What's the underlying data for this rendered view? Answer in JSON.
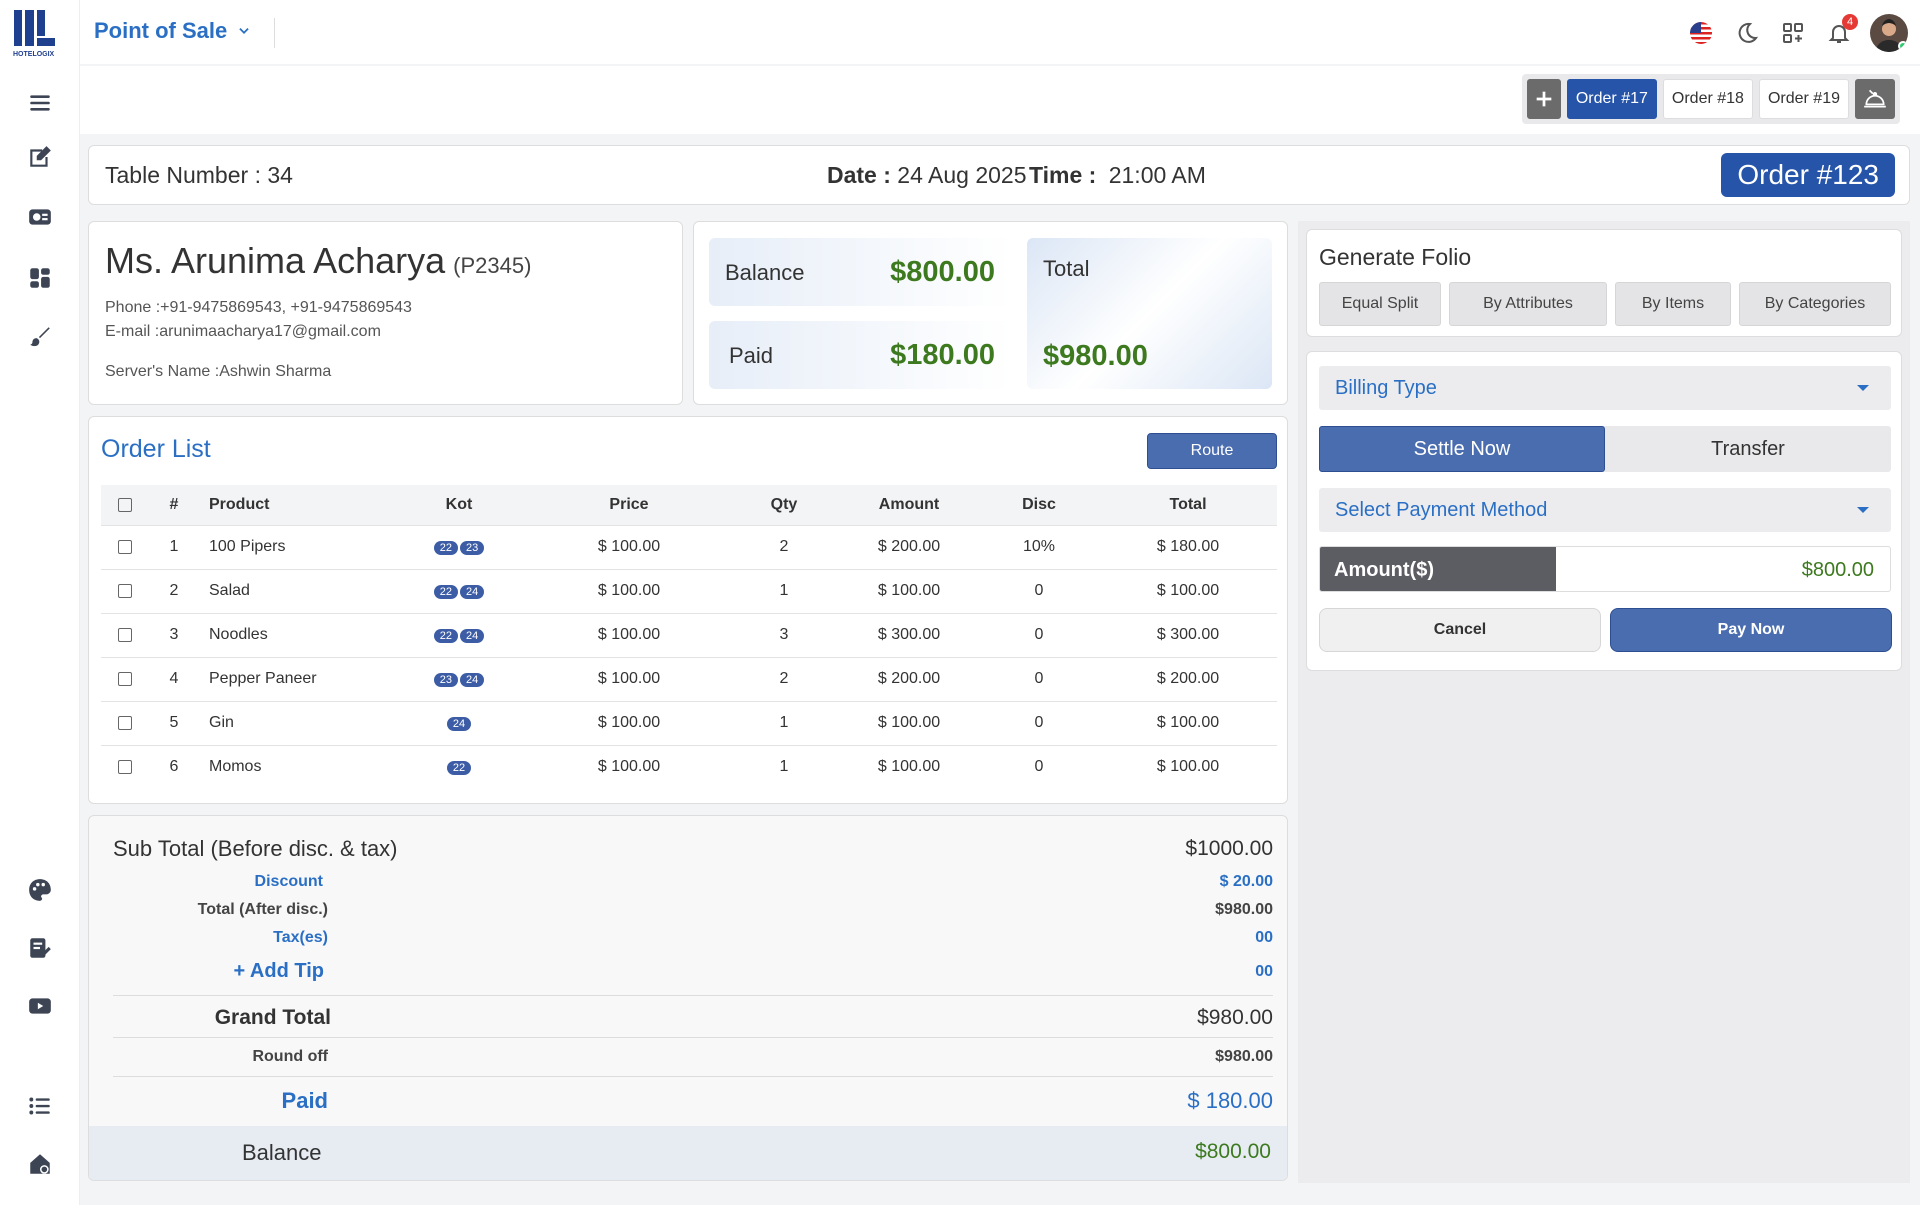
{
  "app": {
    "title": "Point of Sale",
    "logo_text": "HOTELOGIX"
  },
  "notifications": {
    "count": "4"
  },
  "order_tabs": [
    "Order #17",
    "Order #18",
    "Order #19"
  ],
  "table_bar": {
    "table_label": "Table Number :",
    "table_value": "34",
    "date_label": "Date :",
    "date_value": "24 Aug 2025",
    "time_label": "Time :",
    "time_value": "21:00 AM",
    "order_number": "Order #123"
  },
  "guest": {
    "name": "Ms. Arunima Acharya",
    "code": "(P2345)",
    "phone_label": "Phone :",
    "phone": "+91-9475869543, +91-9475869543",
    "email_label": "E-mail :",
    "email": "arunimaacharya17@gmail.com",
    "server_label": "Server's Name :",
    "server": "Ashwin Sharma"
  },
  "balance_card": {
    "balance_label": "Balance",
    "balance_value": "$800.00",
    "paid_label": "Paid",
    "paid_value": "$180.00",
    "total_label": "Total",
    "total_value": "$980.00"
  },
  "order_list": {
    "title": "Order List",
    "route_label": "Route",
    "columns": [
      "#",
      "Product",
      "Kot",
      "Price",
      "Qty",
      "Amount",
      "Disc",
      "Total"
    ],
    "rows": [
      {
        "num": "1",
        "product": "100 Pipers",
        "kot": [
          "22",
          "23"
        ],
        "price": "$ 100.00",
        "qty": "2",
        "amount": "$ 200.00",
        "disc": "10%",
        "total": "$ 180.00"
      },
      {
        "num": "2",
        "product": "Salad",
        "kot": [
          "22",
          "24"
        ],
        "price": "$ 100.00",
        "qty": "1",
        "amount": "$ 100.00",
        "disc": "0",
        "total": "$ 100.00"
      },
      {
        "num": "3",
        "product": "Noodles",
        "kot": [
          "22",
          "24"
        ],
        "price": "$ 100.00",
        "qty": "3",
        "amount": "$ 300.00",
        "disc": "0",
        "total": "$ 300.00"
      },
      {
        "num": "4",
        "product": "Pepper Paneer",
        "kot": [
          "23",
          "24"
        ],
        "price": "$ 100.00",
        "qty": "2",
        "amount": "$ 200.00",
        "disc": "0",
        "total": "$ 200.00"
      },
      {
        "num": "5",
        "product": "Gin",
        "kot": [
          "24"
        ],
        "price": "$ 100.00",
        "qty": "1",
        "amount": "$ 100.00",
        "disc": "0",
        "total": "$ 100.00"
      },
      {
        "num": "6",
        "product": "Momos",
        "kot": [
          "22"
        ],
        "price": "$ 100.00",
        "qty": "1",
        "amount": "$ 100.00",
        "disc": "0",
        "total": "$ 100.00"
      }
    ]
  },
  "summary": {
    "subtotal_label": "Sub Total (Before disc. & tax)",
    "subtotal_value": "$1000.00",
    "discount_label": "Discount",
    "discount_value": "$ 20.00",
    "after_disc_label": "Total (After disc.)",
    "after_disc_value": "$980.00",
    "tax_label": "Tax(es)",
    "tax_value": "00",
    "tip_label": "+ Add Tip",
    "tip_value": "00",
    "grand_label": "Grand Total",
    "grand_value": "$980.00",
    "roundoff_label": "Round off",
    "roundoff_value": "$980.00",
    "paid_label": "Paid",
    "paid_value": "$ 180.00",
    "balance_label": "Balance",
    "balance_value": "$800.00"
  },
  "folio": {
    "title": "Generate Folio",
    "buttons": [
      "Equal Split",
      "By Attributes",
      "By Items",
      "By Categories"
    ]
  },
  "payment": {
    "billing_type": "Billing Type",
    "settle_label": "Settle Now",
    "transfer_label": "Transfer",
    "payment_method": "Select Payment Method",
    "amount_label": "Amount($)",
    "amount_value": "$800.00",
    "cancel_label": "Cancel",
    "pay_label": "Pay Now"
  },
  "colors": {
    "accent": "#2554a8",
    "link": "#2a6fc4",
    "money": "#3d7a1f"
  }
}
